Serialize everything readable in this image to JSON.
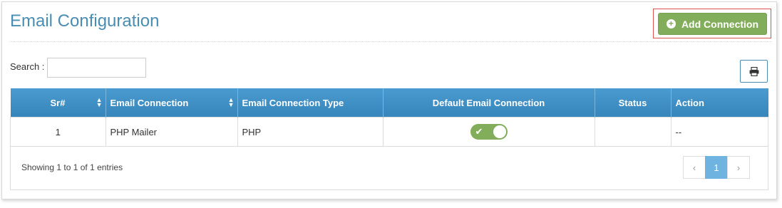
{
  "header": {
    "title": "Email Configuration",
    "add_button_label": "Add Connection"
  },
  "search": {
    "label": "Search :",
    "value": "",
    "placeholder": ""
  },
  "table": {
    "columns": [
      "Sr#",
      "Email Connection",
      "Email Connection Type",
      "Default Email Connection",
      "Status",
      "Action"
    ],
    "rows": [
      {
        "sr": "1",
        "email_connection": "PHP Mailer",
        "type": "PHP",
        "default": "on",
        "status": "",
        "action": "--"
      }
    ]
  },
  "footer": {
    "info": "Showing 1 to 1 of 1 entries",
    "pagination": {
      "prev": "‹",
      "current": "1",
      "next": "›"
    }
  },
  "colors": {
    "accent": "#4a8db2",
    "header_bg": "#3d8fc4",
    "success": "#82ad5a",
    "highlight": "#d9534f"
  },
  "icons": {
    "add": "plus-circle-icon",
    "print": "printer-icon",
    "sort": "sort-icon",
    "toggle_check": "check-icon"
  }
}
